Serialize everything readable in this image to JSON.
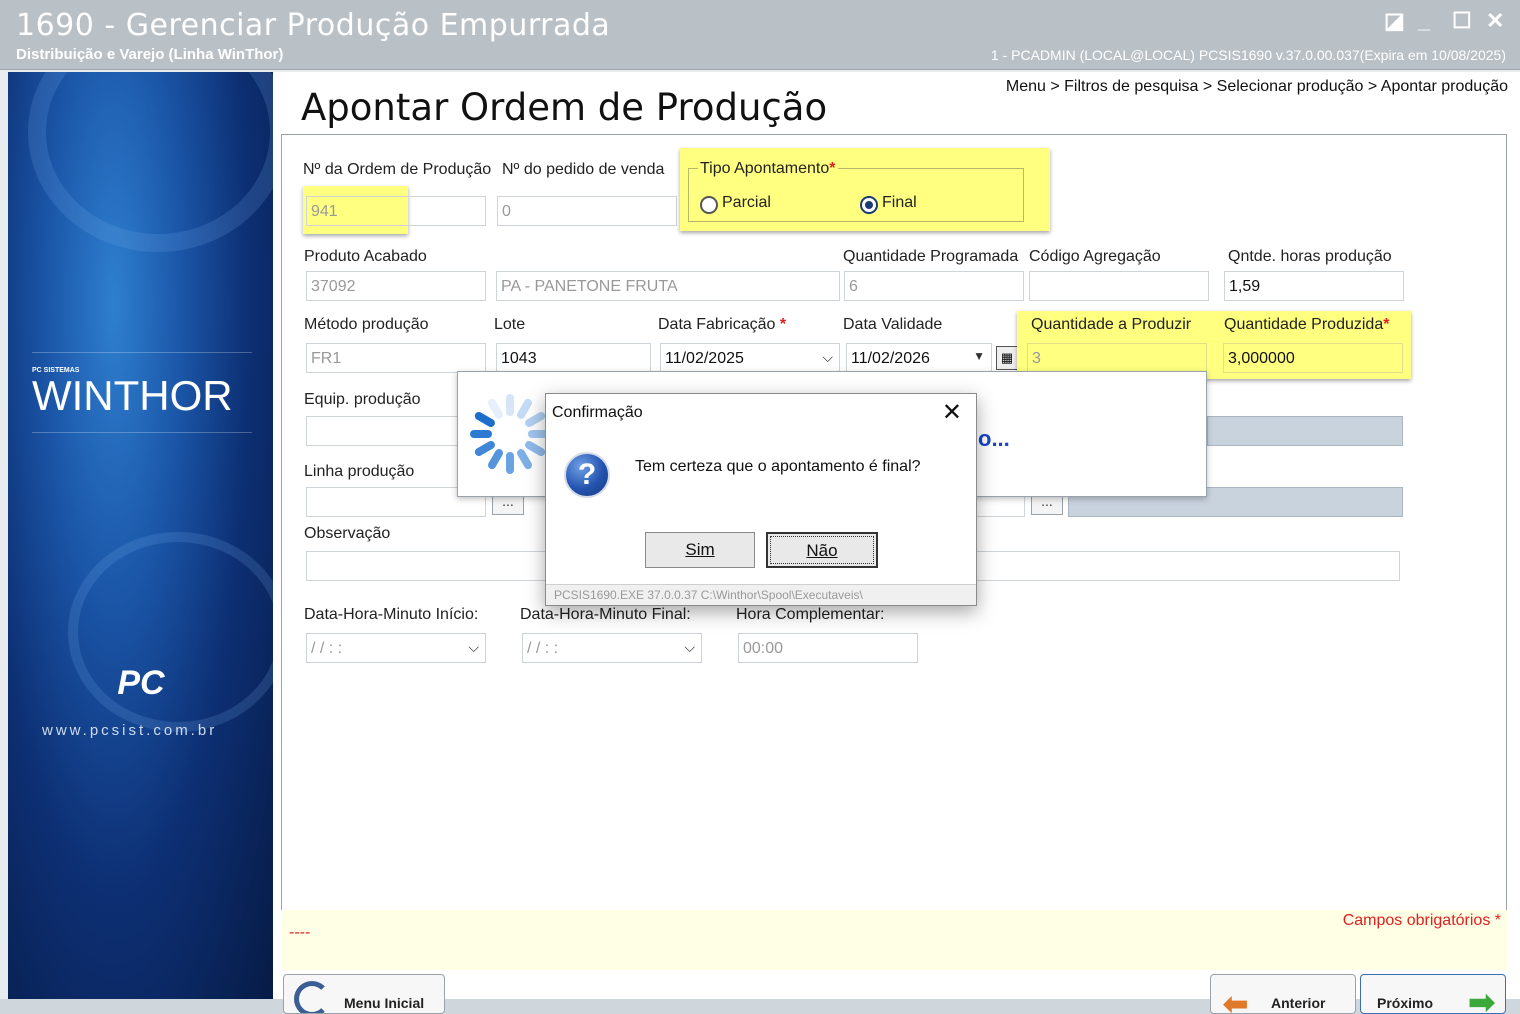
{
  "window": {
    "title": "1690 - Gerenciar Produção Empurrada",
    "subtitle": "Distribuição e Varejo (Linha WinThor)",
    "user_info": "1 - PCADMIN (LOCAL@LOCAL)   PCSIS1690  v.37.0.00.037(Expira em 10/08/2025)"
  },
  "sidebar": {
    "brand_small": "PC SISTEMAS",
    "brand": "WINTHOR",
    "pc_logo": "PC",
    "site": "www.pcsist.com.br"
  },
  "page": {
    "title": "Apontar Ordem de Produção",
    "breadcrumb": "Menu > Filtros de pesquisa > Selecionar produção > Apontar produção"
  },
  "form": {
    "ordem_label": "Nº da Ordem de Produção",
    "ordem_value": "941",
    "pedido_label": "Nº do pedido de venda",
    "pedido_value": "0",
    "tipo_label": "Tipo Apontamento",
    "tipo_parcial": "Parcial",
    "tipo_final": "Final",
    "tipo_selected": "Final",
    "produto_label": "Produto Acabado",
    "produto_code": "37092",
    "produto_desc": "PA - PANETONE FRUTA",
    "qtd_prog_label": "Quantidade Programada",
    "qtd_prog_value": "6",
    "cod_agreg_label": "Código Agregação",
    "cod_agreg_value": "",
    "horas_label": "Qntde. horas produção",
    "horas_value": "1,59",
    "metodo_label": "Método produção",
    "metodo_value": "FR1",
    "lote_label": "Lote",
    "lote_value": "1043",
    "fab_label": "Data Fabricação",
    "fab_value": "11/02/2025",
    "val_label": "Data Validade",
    "val_value": "11/02/2026",
    "qtd_prod_label": "Quantidade a Produzir",
    "qtd_prod_value": "3",
    "qtd_produzida_label": "Quantidade Produzida",
    "qtd_produzida_value": "3,000000",
    "equip_label": "Equip. produção",
    "linha_label": "Linha produção",
    "obs_label": "Observação",
    "ini_label": "Data-Hora-Minuto Início:",
    "ini_value": "/ /     : :",
    "fin_label": "Data-Hora-Minuto Final:",
    "fin_value": "/ /     : :",
    "comp_label": "Hora Complementar:",
    "comp_value": "00:00",
    "ellipsis": "..."
  },
  "footer": {
    "dash": "----",
    "required": "Campos obrigatórios",
    "required_star": "*"
  },
  "nav": {
    "menu_inicial": "Menu Inicial",
    "anterior": "Anterior",
    "proximo": "Próximo"
  },
  "loader": {
    "text": "o..."
  },
  "dialog": {
    "title": "Confirmação",
    "message": "Tem certeza que o apontamento é final?",
    "yes": "Sim",
    "no": "Não",
    "status": "PCSIS1690.EXE 37.0.0.37 C:\\Winthor\\Spool\\Executaveis\\"
  },
  "colors": {
    "highlight": "#ffff80",
    "required": "#e02020",
    "accent_blue": "#1547c8"
  }
}
